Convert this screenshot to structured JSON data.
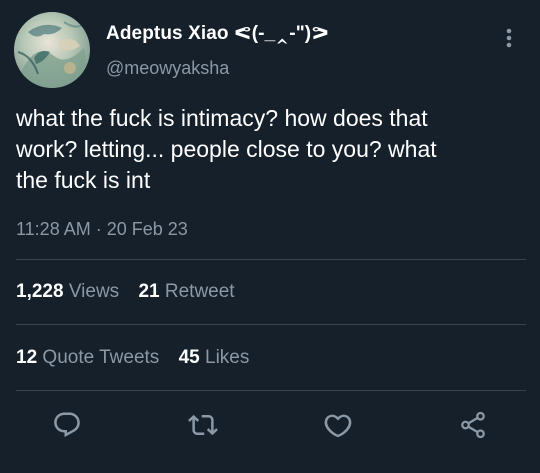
{
  "tweet": {
    "author": {
      "display_name": "Adeptus Xiao ᕙ(-_‸-\")ᕗ",
      "handle": "@meowyaksha"
    },
    "text": "what the fuck is intimacy? how does that\nwork? letting... people close to you? what\nthe fuck is int",
    "timestamp": "11:28 AM · 20 Feb 23"
  },
  "stats": {
    "views": {
      "count": "1,228",
      "label": "Views"
    },
    "retweets": {
      "count": "21",
      "label": "Retweet"
    },
    "quote_tweets": {
      "count": "12",
      "label": "Quote Tweets"
    },
    "likes": {
      "count": "45",
      "label": "Likes"
    }
  },
  "icons": {
    "more": "more-vertical-icon",
    "reply": "reply-icon",
    "retweet": "retweet-icon",
    "like": "like-icon",
    "share": "share-icon"
  },
  "colors": {
    "background": "#15202b",
    "text": "#ffffff",
    "muted": "#8b98a5",
    "divider": "#38444d"
  }
}
